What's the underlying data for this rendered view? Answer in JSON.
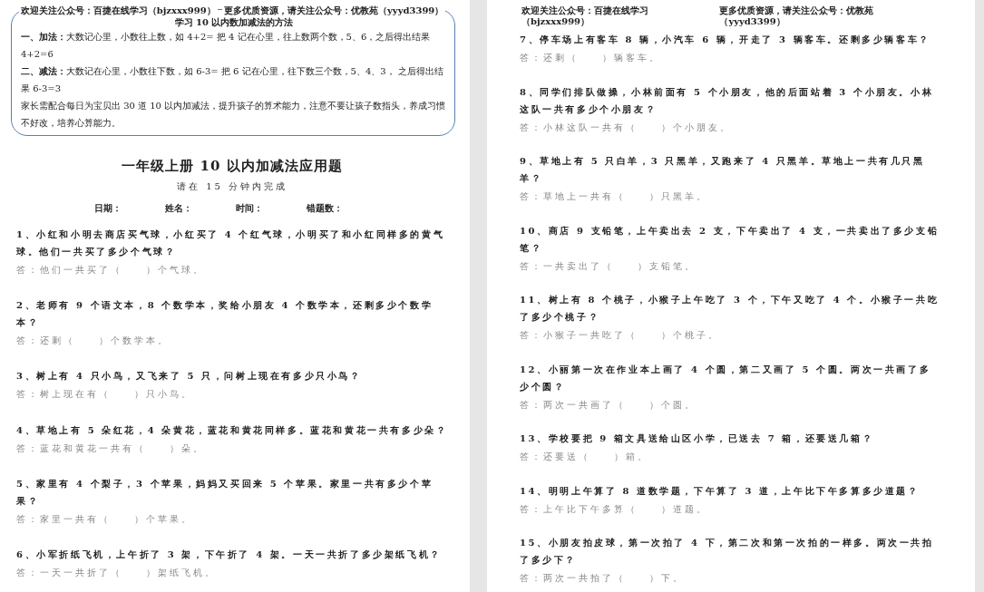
{
  "pages": [
    {
      "header": [
        "欢迎关注公众号：百捷在线学习（bjzxxx999）",
        "更多优质资源，请关注公众号：优教苑（yyyd3399）"
      ],
      "intro": {
        "title": "学习 10 以内数加减法的方法",
        "lines": [
          "**一、加法：**大数记心里，小数往上数，如 4+2= 把 4 记在心里，往上数两个数，5、6，之后得出结果 4+2=6",
          "**二、减法：**大数记在心里，小数往下数，如 6-3= 把 6 记在心里，往下数三个数，5、4、3， 之后得出结果 6-3=3",
          "家长需配合每日为宝贝出 30 道 10 以内加减法，提升孩子的算术能力，注意不要让孩子数指头，养成习惯不好改，培养心算能力。"
        ]
      },
      "title": "一年级上册 10 以内加减法应用题",
      "subtitle": "请在 15 分钟内完成",
      "fields": [
        "日期：",
        "姓名：",
        "时间：",
        "错题数："
      ],
      "questions": [
        {
          "text": "1、小红和小明去商店买气球，小红买了 4 个红气球，小明买了和小红同样多的黄气球。他们一共买了多少个气球？",
          "answer": "答：他们一共买了（　　）个气球。"
        },
        {
          "text": "2、老师有 9 个语文本，8 个数学本，奖给小朋友 4 个数学本，还剩多少个数学本？",
          "answer": "答：还剩（　　）个数学本。"
        },
        {
          "text": "3、树上有 4 只小鸟，又飞来了 5 只，问树上现在有多少只小鸟？",
          "answer": "答：树上现在有（　　）只小鸟。"
        },
        {
          "text": "4、草地上有 5 朵红花，4 朵黄花，蓝花和黄花同样多。蓝花和黄花一共有多少朵？",
          "answer": "答：蓝花和黄花一共有（　　）朵。"
        },
        {
          "text": "5、家里有 4 个梨子，3 个苹果，妈妈又买回来 5 个苹果。家里一共有多少个苹果？",
          "answer": "答：家里一共有（　　）个苹果。"
        },
        {
          "text": "6、小军折纸飞机，上午折了 3 架，下午折了 4 架。一天一共折了多少架纸飞机？",
          "answer": "答：一天一共折了（　　）架纸飞机。"
        }
      ]
    },
    {
      "header": [
        "欢迎关注公众号：百捷在线学习（bjzxxx999）",
        "更多优质资源，请关注公众号：优教苑（yyyd3399）"
      ],
      "questions": [
        {
          "text": "7、停车场上有客车 8 辆，小汽车 6 辆，开走了 3 辆客车。还剩多少辆客车？",
          "answer": "答：还剩（　　）辆客车。"
        },
        {
          "text": "8、同学们排队做操，小林前面有 5 个小朋友，他的后面站着 3 个小朋友。小林这队一共有多少个小朋友？",
          "answer": "答：小林这队一共有（　　）个小朋友。"
        },
        {
          "text": "9、草地上有 5 只白羊，3 只黑羊，又跑来了 4 只黑羊。草地上一共有几只黑羊？",
          "answer": "答：草地上一共有（　　）只黑羊。"
        },
        {
          "text": "10、商店 9 支铅笔，上午卖出去 2 支，下午卖出了 4 支，一共卖出了多少支铅笔？",
          "answer": "答：一共卖出了（　　）支铅笔。"
        },
        {
          "text": "11、树上有 8 个桃子，小猴子上午吃了 3 个，下午又吃了 4 个。小猴子一共吃了多少个桃子？",
          "answer": "答：小猴子一共吃了（　　）个桃子。"
        },
        {
          "text": "12、小丽第一次在作业本上画了 4 个圆，第二又画了 5 个圆。两次一共画了多少个圆？",
          "answer": "答：两次一共画了（　　）个圆。"
        },
        {
          "text": "13、学校要把 9 箱文具送给山区小学，已送去 7 箱，还要送几箱？",
          "answer": "答：还要送（　　）箱。"
        },
        {
          "text": "14、明明上午算了 8 道数学题，下午算了 3 道，上午比下午多算多少道题？",
          "answer": "答：上午比下午多算（　　）道题。"
        },
        {
          "text": "15、小朋友拍皮球，第一次拍了 4 下，第二次和第一次拍的一样多。两次一共拍了多少下？",
          "answer": "答：两次一共拍了（　　）下。"
        }
      ]
    }
  ]
}
